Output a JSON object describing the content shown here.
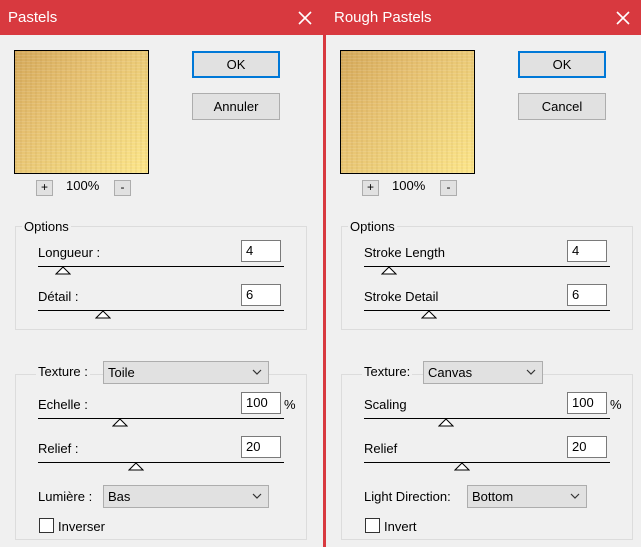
{
  "left": {
    "title": "Pastels",
    "ok_label": "OK",
    "cancel_label": "Annuler",
    "zoom_in": "+",
    "zoom_out": "-",
    "zoom_level": "100%",
    "options_group": "Options",
    "length_label": "Longueur :",
    "length_value": "4",
    "detail_label": "Détail :",
    "detail_value": "6",
    "texture_label": "Texture :",
    "texture_value": "Toile",
    "scale_label": "Echelle :",
    "scale_value": "100",
    "scale_unit": "%",
    "relief_label": "Relief :",
    "relief_value": "20",
    "light_label": "Lumière :",
    "light_value": "Bas",
    "invert_label": "Inverser",
    "invert_checked": false
  },
  "right": {
    "title": "Rough Pastels",
    "ok_label": "OK",
    "cancel_label": "Cancel",
    "zoom_in": "+",
    "zoom_out": "-",
    "zoom_level": "100%",
    "options_group": "Options",
    "length_label": "Stroke Length",
    "length_value": "4",
    "detail_label": "Stroke Detail",
    "detail_value": "6",
    "texture_label": "Texture:",
    "texture_value": "Canvas",
    "scale_label": "Scaling",
    "scale_value": "100",
    "scale_unit": "%",
    "relief_label": "Relief",
    "relief_value": "20",
    "light_label": "Light Direction:",
    "light_value": "Bottom",
    "invert_label": "Invert",
    "invert_checked": false
  },
  "colors": {
    "titlebar": "#d8393f",
    "default_button_border": "#0078d7",
    "dialog_background": "#f0f0f0"
  },
  "icons": {
    "close": "close-icon",
    "dropdown": "chevron-down-icon",
    "slider_thumb": "slider-thumb-icon"
  }
}
